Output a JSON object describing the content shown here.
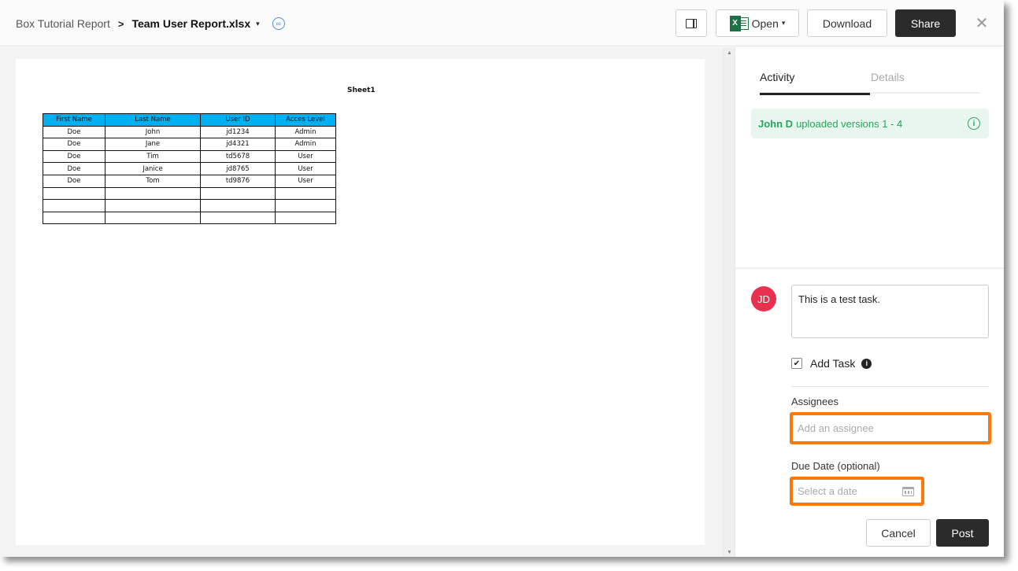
{
  "header": {
    "breadcrumb_parent": "Box Tutorial Report",
    "breadcrumb_separator": ">",
    "file_name": "Team User Report.xlsx",
    "file_caret": "▾",
    "link_icon": "∞",
    "open_label": "Open",
    "open_caret": "▾",
    "download_label": "Download",
    "share_label": "Share",
    "close_glyph": "✕"
  },
  "preview": {
    "sheet_title": "Sheet1",
    "columns": [
      "First Name",
      "Last Name",
      "User ID",
      "Acces Level"
    ],
    "rows": [
      [
        "Doe",
        "John",
        "jd1234",
        "Admin"
      ],
      [
        "Doe",
        "Jane",
        "jd4321",
        "Admin"
      ],
      [
        "Doe",
        "Tim",
        "td5678",
        "User"
      ],
      [
        "Doe",
        "Janice",
        "jd8765",
        "User"
      ],
      [
        "Doe",
        "Tom",
        "td9876",
        "User"
      ],
      [
        "",
        "",
        "",
        ""
      ],
      [
        "",
        "",
        "",
        ""
      ],
      [
        "",
        "",
        "",
        ""
      ]
    ],
    "header_color": "#00b0f0"
  },
  "sidebar": {
    "tabs": [
      {
        "label": "Activity",
        "active": true
      },
      {
        "label": "Details",
        "active": false
      }
    ],
    "activity": {
      "user": "John D",
      "text": "uploaded versions 1 - 4",
      "info_glyph": "i"
    },
    "comment": {
      "avatar_initials": "JD",
      "avatar_color": "#e9304e",
      "text": "This is a test task.",
      "add_task_label": "Add Task",
      "add_task_checked": true,
      "checkmark": "✔",
      "info_glyph": "i",
      "assignees_label": "Assignees",
      "assignee_placeholder": "Add an assignee",
      "due_date_label": "Due Date (optional)",
      "due_date_placeholder": "Select a date",
      "cancel_label": "Cancel",
      "post_label": "Post"
    },
    "highlight_color": "#f97a0a"
  }
}
